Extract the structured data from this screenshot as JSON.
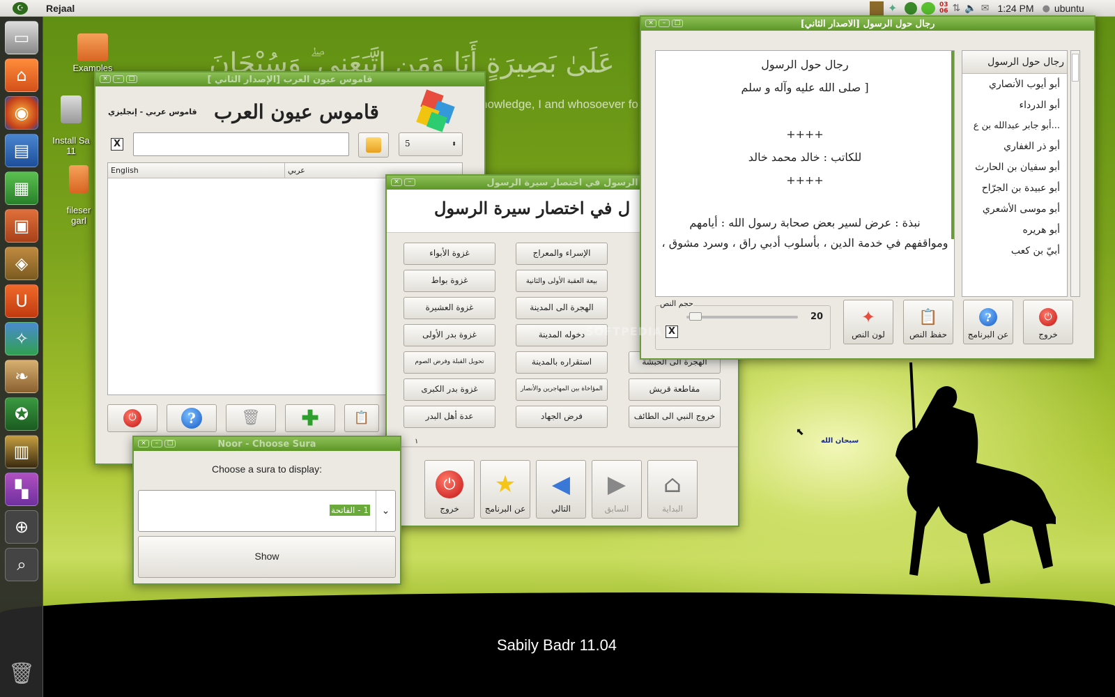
{
  "topbar": {
    "app_name": "Rejaal",
    "clock": "1:24 PM",
    "user": "ubuntu",
    "badge_top": "03",
    "badge_bottom": "06"
  },
  "desktop": {
    "icons": [
      {
        "label": "Examples"
      },
      {
        "label": "Install Sa\n11"
      },
      {
        "label": "fileser\ngarl"
      }
    ],
    "wallpaper_arabic": "عَلَىٰ بَصِيرَةٍ أَنَا وَمَنِ اتَّبَعَنِي ۖ وَسُبْحَانَ",
    "wallpaper_english": "nowledge, I and whosoever fo",
    "subhan": "سبحان الله",
    "distro_label": "Sabily Badr 11.04",
    "watermark": "SOFTPEDIA"
  },
  "launcher": [
    "hdd-icon",
    "home-icon",
    "firefox-icon",
    "writer-icon",
    "calc-icon",
    "impress-icon",
    "software-center-icon",
    "ubuntu-one-icon",
    "quran-app-icon",
    "bookmark-icon",
    "noor-icon",
    "mosque-icon",
    "workspace-icon",
    "zoom-in-icon",
    "zoom-search-icon"
  ],
  "dictionary": {
    "title": "[ قاموس عيون العرب [الإصدار الثاني",
    "heading": "قاموس عيون العرب",
    "subheading": "قاموس عربي - إنجليزي",
    "x_label": "X",
    "search_value": "",
    "count_value": "5",
    "col_english": "English",
    "col_arabic": "عربي"
  },
  "sira": {
    "title": "الرسول في اختصار سيرة الرسول",
    "heading": "ل في اختصار سيرة الرسول",
    "page_number": "١",
    "col1": [
      "غزوة الأبواء",
      "غزوة بواط",
      "غزوة العشيرة",
      "غزوة بدر الأولى",
      "تحويل القبلة وفرض الصوم",
      "غزوة بدر الكبرى",
      "عدة أهل البدر"
    ],
    "col2": [
      "الإسراء والمعراج",
      "بيعة العقبة الأولى والثانية",
      "الهجرة الى المدينة",
      "دخوله المدينة",
      "استقراره بالمدينة",
      "المؤاخاة بين المهاجرين والأنصار",
      "فرض الجهاد"
    ],
    "col3": [
      "الهجرة الى الحبشة",
      "مقاطعة قريش",
      "خروج النبي الى الطائف"
    ],
    "toolbar": {
      "exit": "خروج",
      "about": "عن البرنامج",
      "next": "التالي",
      "prev": "السابق",
      "home": "البداية"
    }
  },
  "noor": {
    "title": "Noor - Choose Sura",
    "prompt": "Choose a sura to display:",
    "selected": "1 - الفاتحة",
    "show": "Show"
  },
  "rejaal": {
    "title": "[رجال حول الرسول [الاصدار الثاني",
    "text": {
      "line1": "رجال حول الرسول",
      "line2": "[ صلى الله عليه وآله و سلم",
      "sep1": "++++",
      "author": "للكاتب : خالد محمد خالد",
      "sep2": "++++",
      "para1": "نبذة : عرض   لسير بعض صحابة رسول الله : أيامهم",
      "para2": "ومواقفهم في خدمة الدين ، بأسلوب أدبي راق ، وسرد مشوق ،"
    },
    "list": [
      "رجال حول الرسول",
      "أبو أيوب الأنصاري",
      "أبو الدرداء",
      "...أبو جابر عبدالله بن ع",
      "أبو ذر الغفاري",
      "أبو سفيان بن الحارث",
      "أبو عبيدة بن الجرّاح",
      "أبو موسى الأشعري",
      "أبو هريره",
      "أبيّ بن كعب"
    ],
    "font_size_label": "حجم النص",
    "font_size_value": "20",
    "x_label": "X",
    "buttons": {
      "color": "لون النص",
      "save": "حفظ النص",
      "about": "عن البرنامج",
      "exit": "خروج"
    }
  }
}
